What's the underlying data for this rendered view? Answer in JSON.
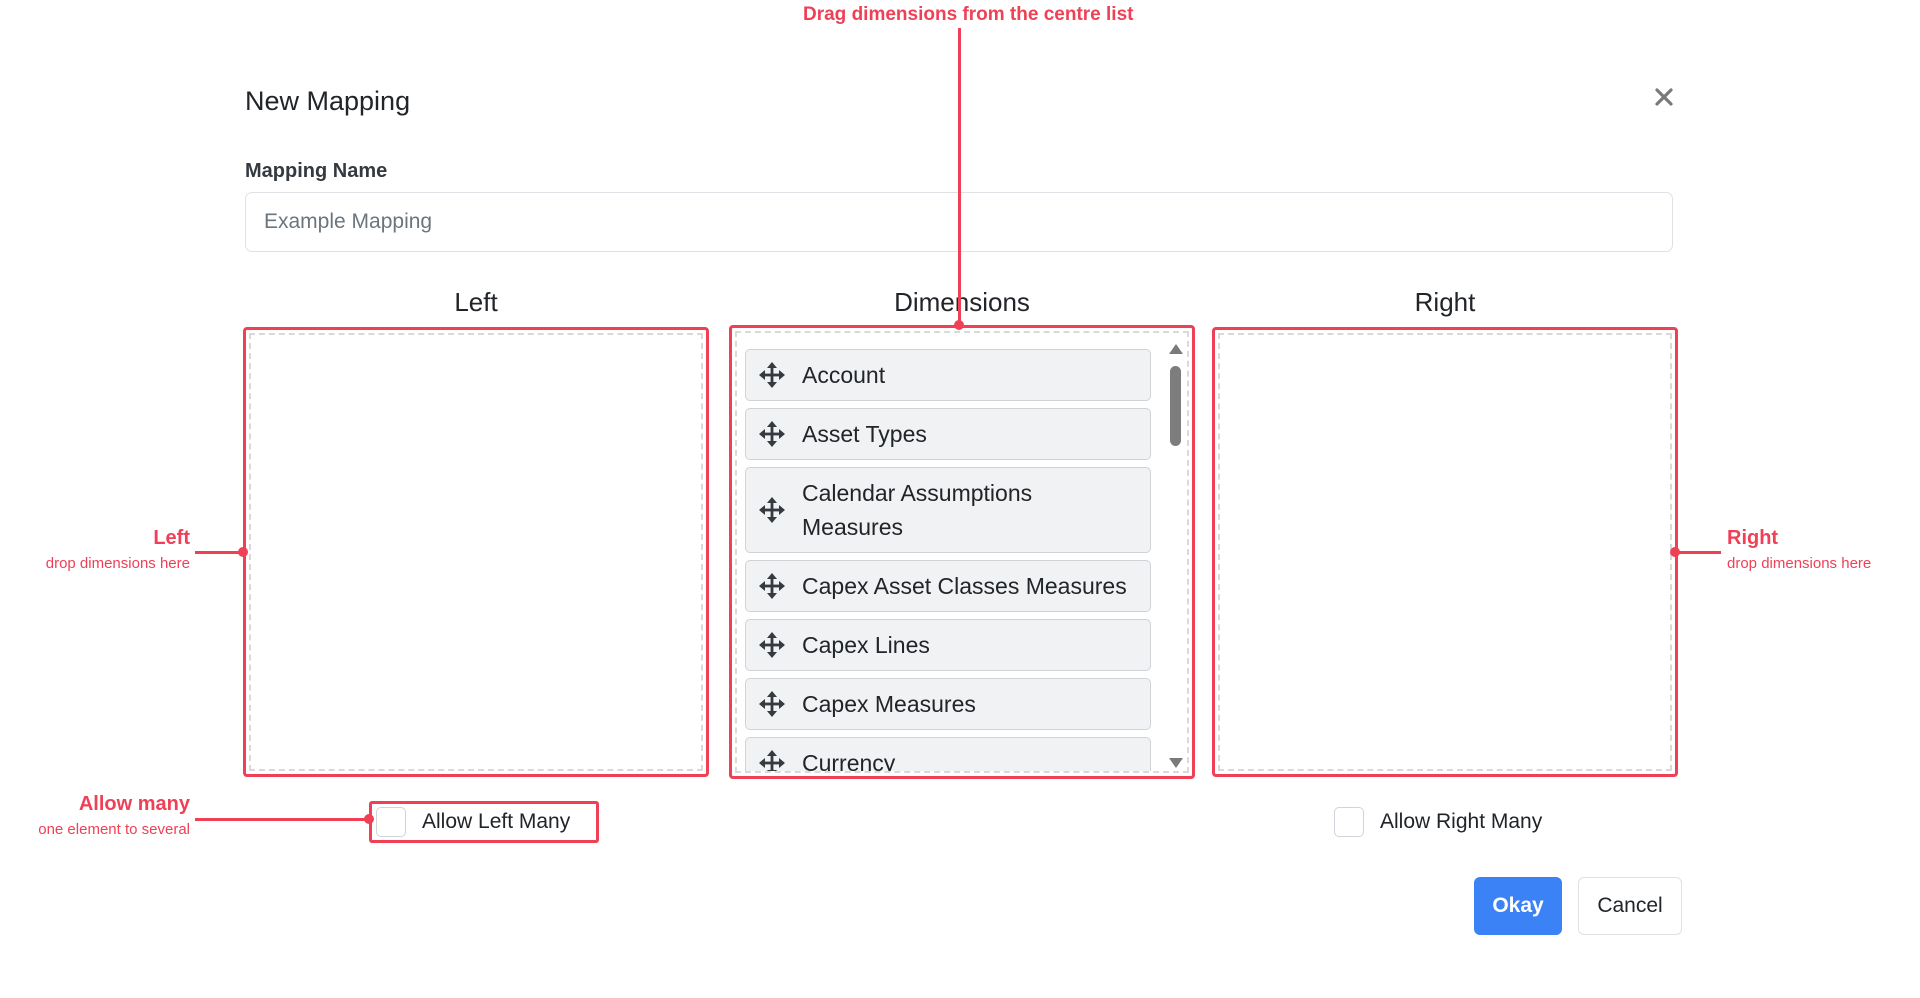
{
  "dialog": {
    "title": "New Mapping",
    "close_icon": "close-icon",
    "mapping_name_label": "Mapping Name",
    "mapping_name_value": "",
    "mapping_name_placeholder": "Example Mapping"
  },
  "columns": {
    "left_title": "Left",
    "dimensions_title": "Dimensions",
    "right_title": "Right"
  },
  "dimensions": {
    "items": [
      {
        "label": "Account",
        "icon": "move-icon"
      },
      {
        "label": "Asset Types",
        "icon": "move-icon"
      },
      {
        "label": "Calendar Assumptions Measures",
        "icon": "move-icon"
      },
      {
        "label": "Capex Asset Classes Measures",
        "icon": "move-icon"
      },
      {
        "label": "Capex Lines",
        "icon": "move-icon"
      },
      {
        "label": "Capex Measures",
        "icon": "move-icon"
      },
      {
        "label": "Currency",
        "icon": "move-icon"
      }
    ]
  },
  "options": {
    "allow_left_many_label": "Allow Left Many",
    "allow_left_many_checked": false,
    "allow_right_many_label": "Allow Right Many",
    "allow_right_many_checked": false
  },
  "buttons": {
    "okay_label": "Okay",
    "cancel_label": "Cancel"
  },
  "annotations": {
    "top_title": "Drag dimensions from the centre list",
    "left_title": "Left",
    "left_sub": "drop dimensions here",
    "right_title": "Right",
    "right_sub": "drop dimensions here",
    "allow_title": "Allow many",
    "allow_sub": "one element to several"
  },
  "colors": {
    "annotation": "#ef4056",
    "primary": "#3b82f6",
    "item_bg": "#f1f2f4"
  }
}
